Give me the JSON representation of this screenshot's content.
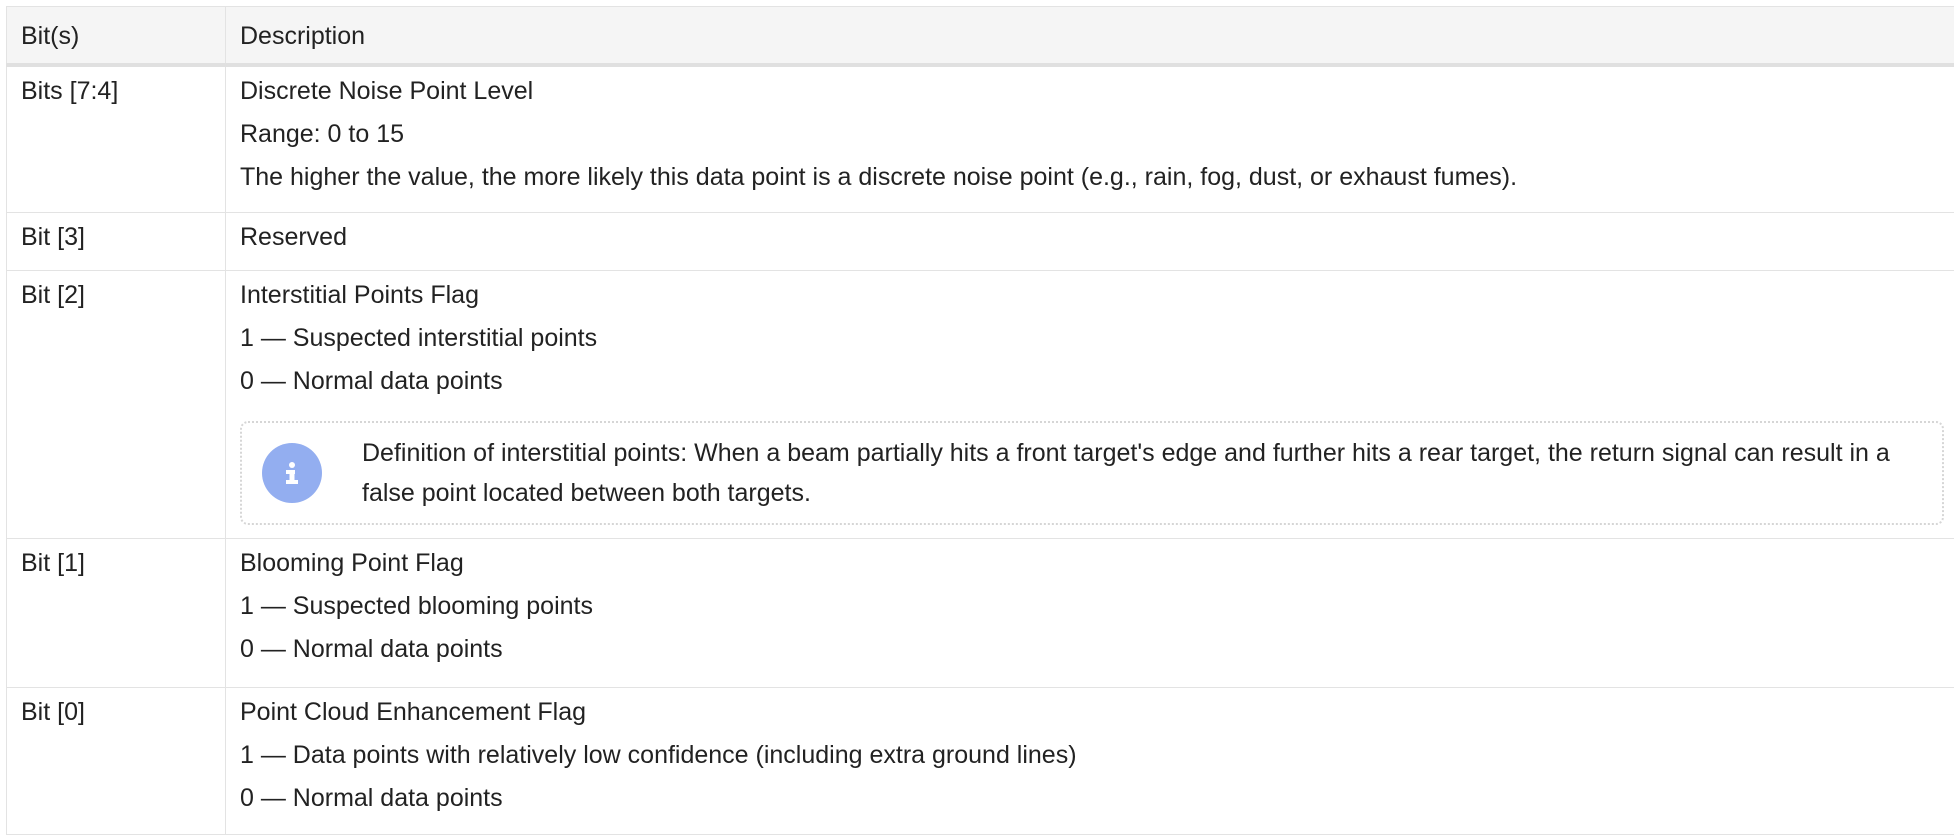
{
  "table": {
    "headers": {
      "bits": "Bit(s)",
      "description": "Description"
    },
    "rows": [
      {
        "bits": "Bits [7:4]",
        "lines": [
          "Discrete Noise Point Level",
          "Range: 0 to 15",
          "The higher the value, the more likely this data point is a discrete noise point (e.g., rain, fog, dust, or exhaust fumes)."
        ]
      },
      {
        "bits": "Bit [3]",
        "lines": [
          "Reserved"
        ]
      },
      {
        "bits": "Bit [2]",
        "lines": [
          "Interstitial Points Flag",
          "1 — Suspected interstitial points",
          "0 — Normal data points"
        ],
        "note": {
          "icon": "info-icon",
          "text": "Definition of interstitial points: When a beam partially hits a front target's edge and further hits a rear target, the return signal can result in a false point located between both targets."
        }
      },
      {
        "bits": "Bit [1]",
        "lines": [
          "Blooming Point Flag",
          "1 — Suspected blooming points",
          "0 — Normal data points"
        ]
      },
      {
        "bits": "Bit [0]",
        "lines": [
          "Point Cloud Enhancement Flag",
          "1 — Data points with relatively low confidence (including extra ground lines)",
          "0 — Normal data points"
        ]
      }
    ]
  },
  "colors": {
    "header_bg": "#f5f5f5",
    "border": "#e3e3e3",
    "info_icon": "#93aef0",
    "text": "#222222"
  }
}
